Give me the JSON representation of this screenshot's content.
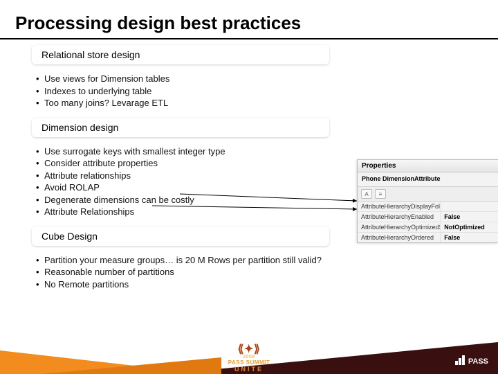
{
  "title": "Processing design best practices",
  "sections": [
    {
      "heading": "Relational store design",
      "bullets": [
        "Use views for Dimension tables",
        "Indexes to underlying table",
        "Too many joins? Levarage ETL"
      ]
    },
    {
      "heading": "Dimension design",
      "bullets": [
        "Use surrogate keys with smallest integer type",
        "Consider attribute properties",
        "Attribute relationships",
        "Avoid ROLAP",
        "Degenerate dimensions can be costly",
        "Attribute Relationships"
      ]
    },
    {
      "heading": "Cube Design",
      "bullets": [
        "Partition your measure groups… is 20 M Rows per partition still valid?",
        "Reasonable number of partitions",
        "No Remote partitions"
      ]
    }
  ],
  "properties_panel": {
    "title": "Properties",
    "subtitle": "Phone  DimensionAttribute",
    "tool_icons": [
      "az-sort-icon",
      "category-icon"
    ],
    "rows": [
      {
        "key": "AttributeHierarchyDisplayFolder",
        "value": ""
      },
      {
        "key": "AttributeHierarchyEnabled",
        "value": "False"
      },
      {
        "key": "AttributeHierarchyOptimizedState",
        "value": "NotOptimized"
      },
      {
        "key": "AttributeHierarchyOrdered",
        "value": "False"
      }
    ]
  },
  "footer": {
    "badge_year": "2009",
    "badge_main": "PASS SUMMIT",
    "badge_sub": "UNITE",
    "logo_text": "PASS"
  }
}
